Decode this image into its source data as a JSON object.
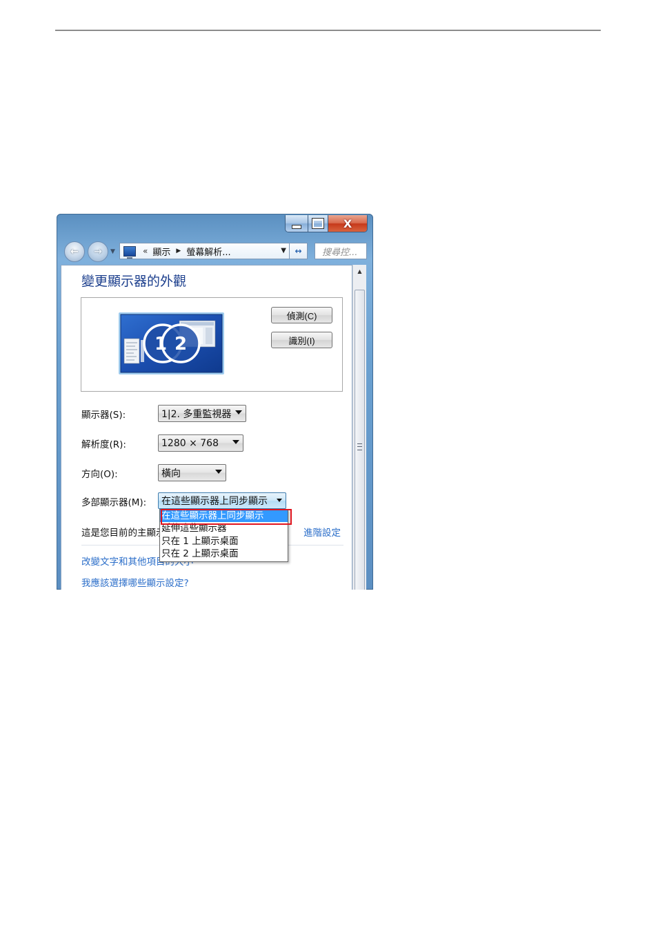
{
  "window": {
    "caption": {
      "minimize_icon": "minimize-icon",
      "maximize_icon": "maximize-icon",
      "close_icon": "close-icon",
      "close_glyph": "X"
    },
    "nav": {
      "back_glyph": "←",
      "forward_glyph": "→"
    },
    "address": {
      "chevrons": "«",
      "crumb1": "顯示",
      "separator": "▶",
      "crumb2": "螢幕解析...",
      "dropdown": "▼"
    },
    "refresh_glyph": "↔",
    "search_placeholder": "搜尋控..."
  },
  "page": {
    "title": "變更顯示器的外觀",
    "detect_button": "偵測(C)",
    "identify_button": "識別(I)",
    "monitor_preview": {
      "monitor1": "1",
      "monitor2": "2"
    },
    "display_label": "顯示器(S):",
    "display_value": "1|2. 多重監視器",
    "resolution_label": "解析度(R):",
    "resolution_value": "1280 × 768",
    "orientation_label": "方向(O):",
    "orientation_value": "橫向",
    "multi_label": "多部顯示器(M):",
    "multi_value": "在這些顯示器上同步顯示",
    "multi_options": [
      "在這些顯示器上同步顯示",
      "延伸這些顯示器",
      "只在 1 上顯示桌面",
      "只在 2 上顯示桌面"
    ],
    "multi_selected_index": 0,
    "primary_text": "這是您目前的主顯示器。",
    "advanced_link": "進階設定",
    "links": [
      "改變文字和其他項目的大小",
      "我應該選擇哪些顯示設定?"
    ]
  },
  "colors": {
    "title_blue": "#1a3d8c",
    "link_blue": "#2b6ec9",
    "highlight_red": "#e0141e",
    "selection_blue": "#3399ff"
  }
}
